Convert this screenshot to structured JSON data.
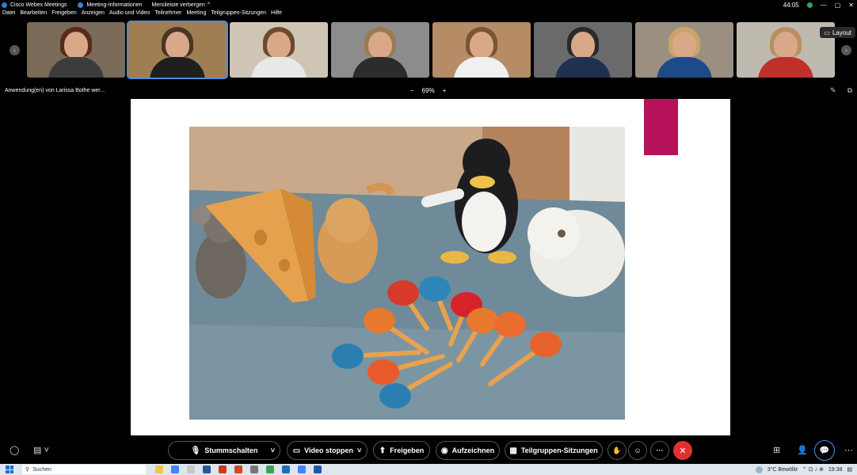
{
  "titlebar": {
    "app_name": "Cisco Webex Meetings",
    "meeting_info": "Meeting-Informationen",
    "hide_menu": "Menüleiste verbergen",
    "timer": "44:05"
  },
  "menu": [
    "Datei",
    "Bearbeiten",
    "Freigeben",
    "Anzeigen",
    "Audio und Video",
    "Teilnehmer",
    "Meeting",
    "Teilgruppen-Sitzungen",
    "Hilfe"
  ],
  "participants": [
    {
      "bg": "#7a6a58",
      "hair": "#5a2a1a",
      "body": "#3b3b3b"
    },
    {
      "bg": "#a07e54",
      "hair": "#4a3526",
      "body": "#1f1f1f"
    },
    {
      "bg": "#cfc5b4",
      "hair": "#6b4a2e",
      "body": "#e8e8e8"
    },
    {
      "bg": "#8c8c8c",
      "hair": "#9a7a50",
      "body": "#2c2c2c"
    },
    {
      "bg": "#b58c66",
      "hair": "#7a5535",
      "body": "#f0f0f0"
    },
    {
      "bg": "#6a6a6a",
      "hair": "#2a2a2a",
      "body": "#203050"
    },
    {
      "bg": "#9a8f80",
      "hair": "#c9a46a",
      "body": "#1e4a8a"
    },
    {
      "bg": "#bfbab0",
      "hair": "#b89060",
      "body": "#c0302a"
    }
  ],
  "layout_button": "Layout",
  "share": {
    "label": "Anwendung(en) von Larissa Bothe wer...",
    "zoom_minus": "−",
    "zoom": "69%",
    "zoom_plus": "+"
  },
  "toolbar": {
    "mute": "Stummschalten",
    "video": "Video stoppen",
    "share": "Freigeben",
    "record": "Aufzeichnen",
    "breakout": "Teilgruppen-Sitzungen",
    "more": "···"
  },
  "taskbar": {
    "search": "Suchen",
    "weather": "3°C  Bewölkt",
    "time": "19:38"
  },
  "colors": {
    "accent": "#b5125a",
    "end_call": "#e0312f",
    "active_blue": "#4a90e2"
  }
}
